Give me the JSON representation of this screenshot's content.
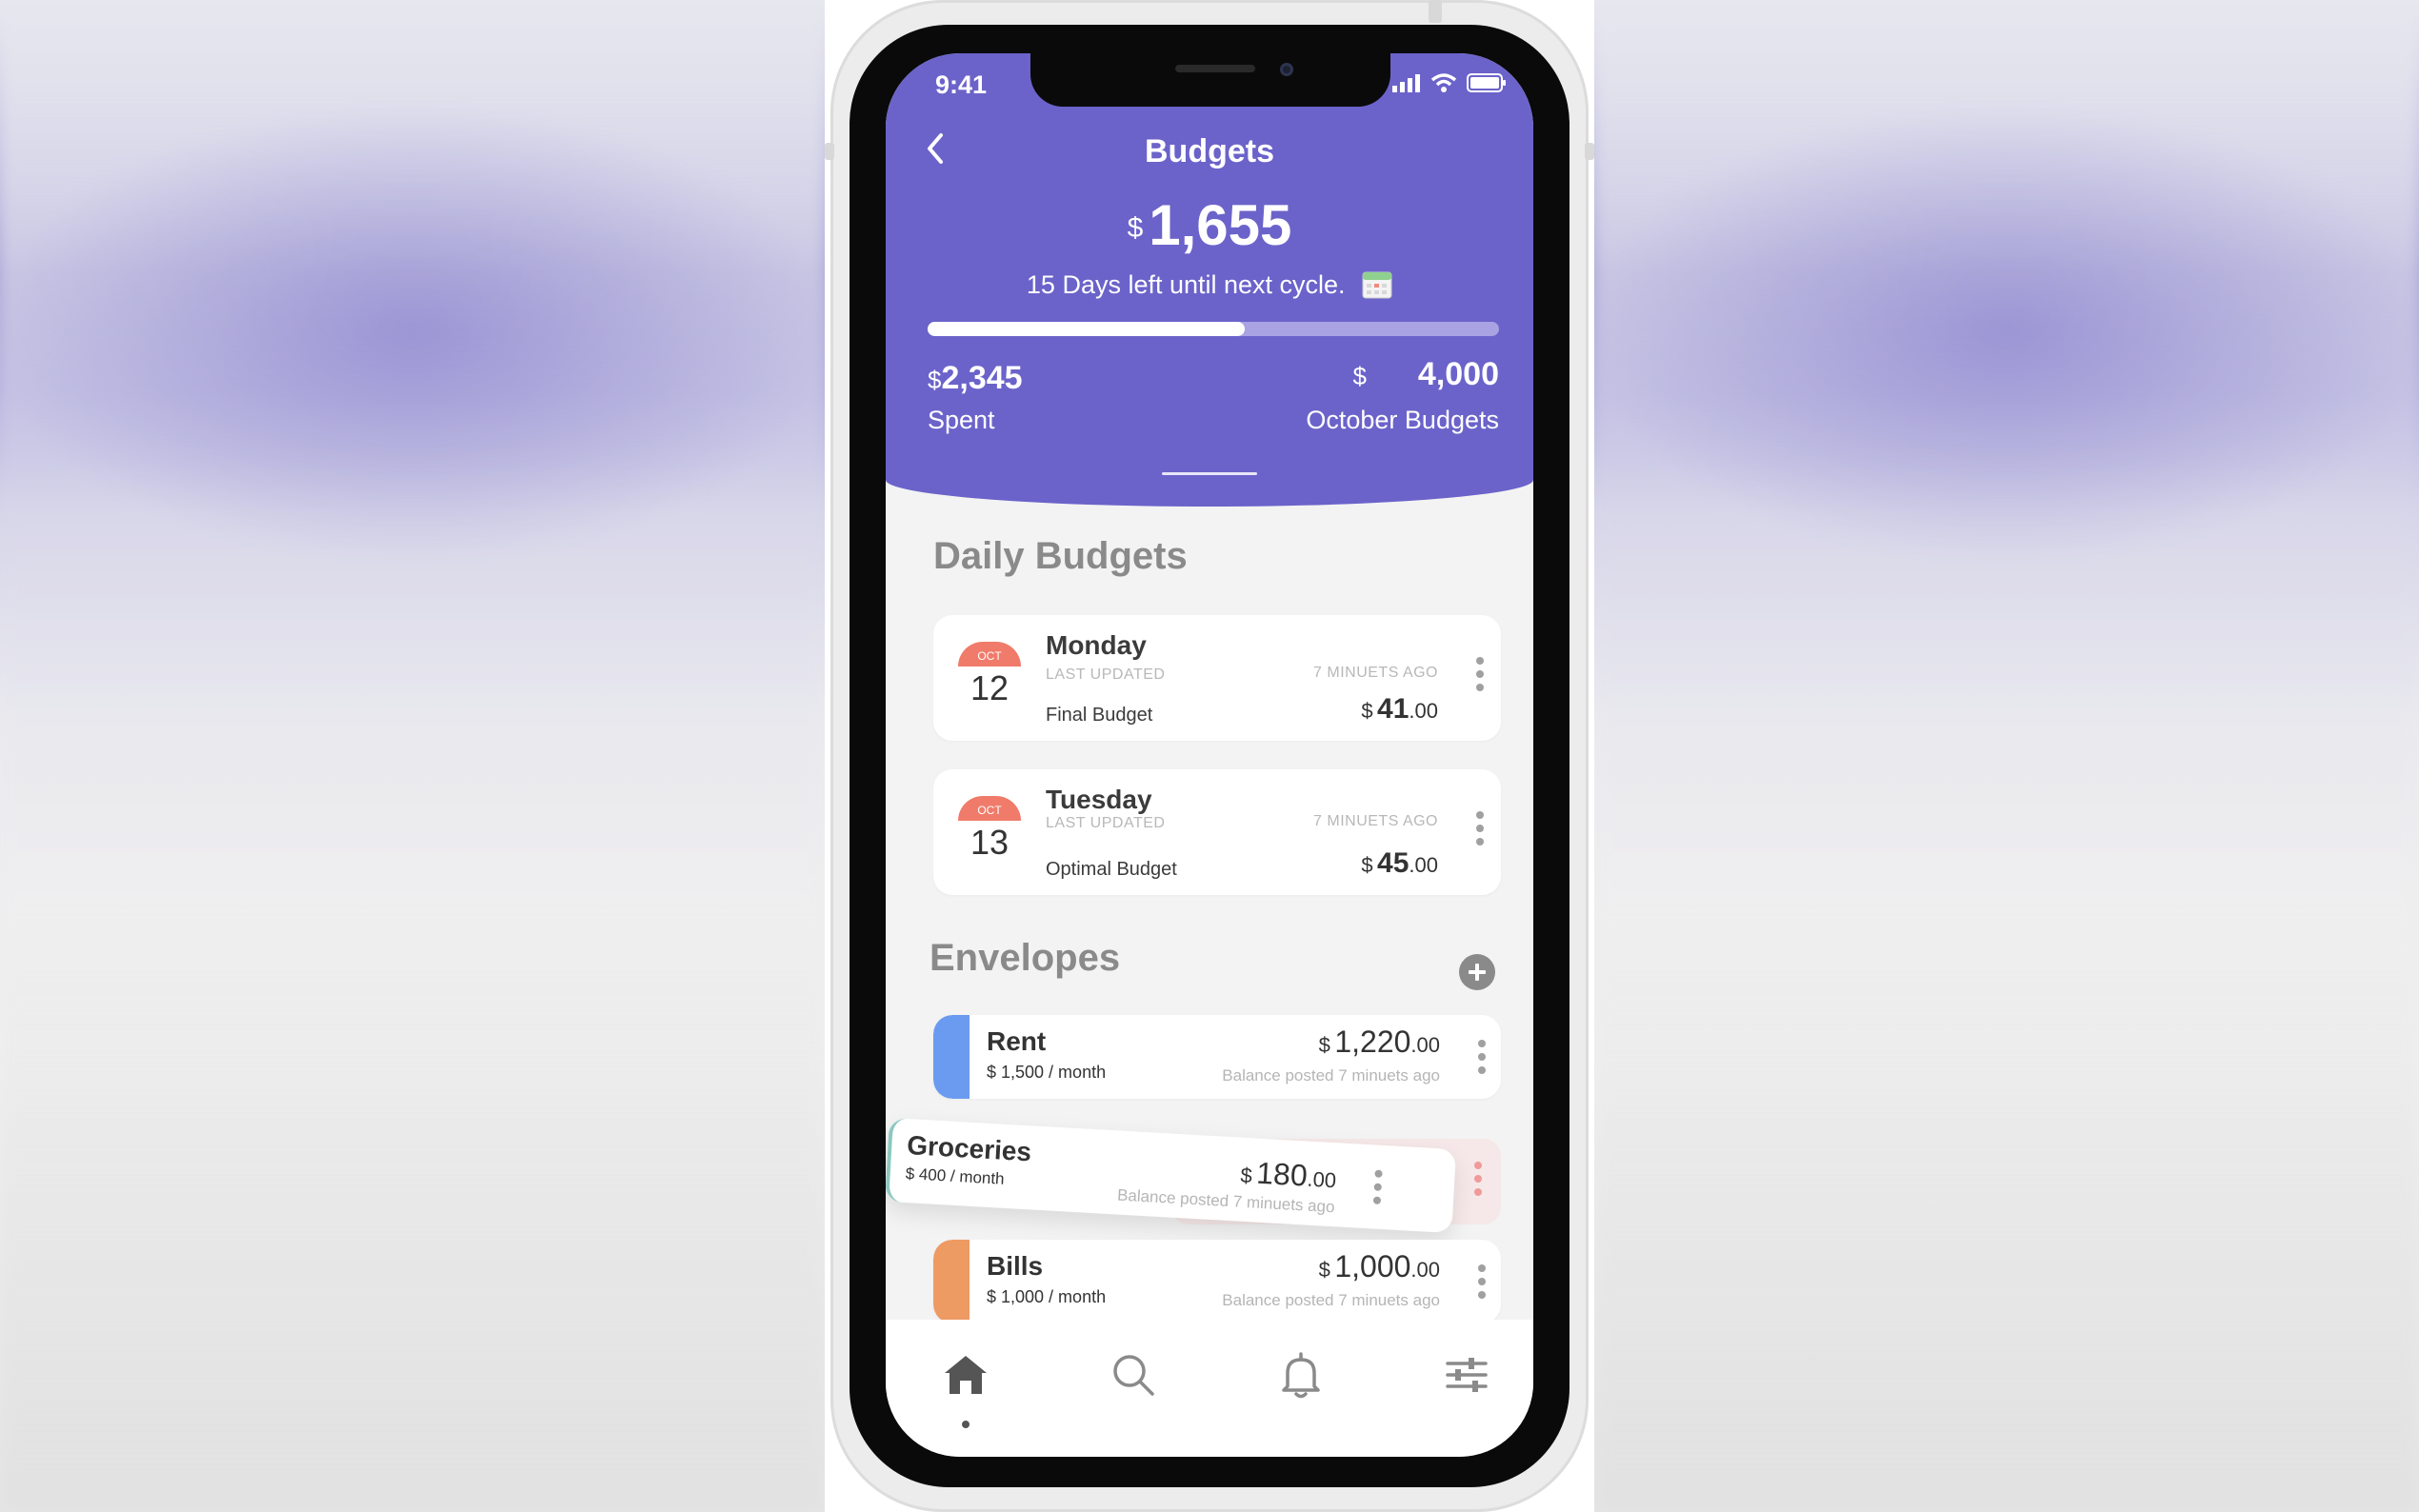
{
  "status_bar": {
    "time": "9:41"
  },
  "header": {
    "title": "Budgets",
    "currency": "$",
    "remaining": "1,655",
    "cycle_text": "15 Days left until next cycle.",
    "progress_fraction": 0.555,
    "spent": {
      "currency": "$",
      "amount": "2,345",
      "label": "Spent"
    },
    "budget": {
      "currency": "$",
      "amount": "4,000",
      "label": "October Budgets"
    }
  },
  "daily_budgets": {
    "title": "Daily Budgets",
    "items": [
      {
        "month": "OCT",
        "day": "12",
        "name": "Monday",
        "last_updated_label": "LAST UPDATED",
        "ago": "7 MINUETS AGO",
        "type": "Final Budget",
        "currency": "$",
        "amount": "41",
        "cents": ".00"
      },
      {
        "month": "OCT",
        "day": "13",
        "name": "Tuesday",
        "last_updated_label": "LAST UPDATED",
        "ago": "7 MINUETS AGO",
        "type": "Optimal Budget",
        "currency": "$",
        "amount": "45",
        "cents": ".00"
      }
    ]
  },
  "envelopes": {
    "title": "Envelopes",
    "items": [
      {
        "name": "Rent",
        "sub": "$ 1,500 / month",
        "currency": "$",
        "amount": "1,220",
        "cents": ".00",
        "posted": "Balance posted 7 minuets ago",
        "color": "#6b9bf0"
      },
      {
        "name": "Groceries",
        "sub": "$ 400 / month",
        "currency": "$",
        "amount": "180",
        "cents": ".00",
        "posted": "Balance posted 7 minuets ago",
        "color": "#8cc9c0"
      },
      {
        "name": "Bills",
        "sub": "$ 1,000 / month",
        "currency": "$",
        "amount": "1,000",
        "cents": ".00",
        "posted": "Balance posted 7 minuets ago",
        "color": "#ee9a63"
      }
    ]
  },
  "tabbar": {
    "tabs": [
      {
        "icon": "home-icon",
        "active": true
      },
      {
        "icon": "search-icon",
        "active": false
      },
      {
        "icon": "bell-icon",
        "active": false
      },
      {
        "icon": "sliders-icon",
        "active": false
      }
    ]
  },
  "colors": {
    "accent": "#6b63ca",
    "date_badge": "#f07b6a"
  }
}
